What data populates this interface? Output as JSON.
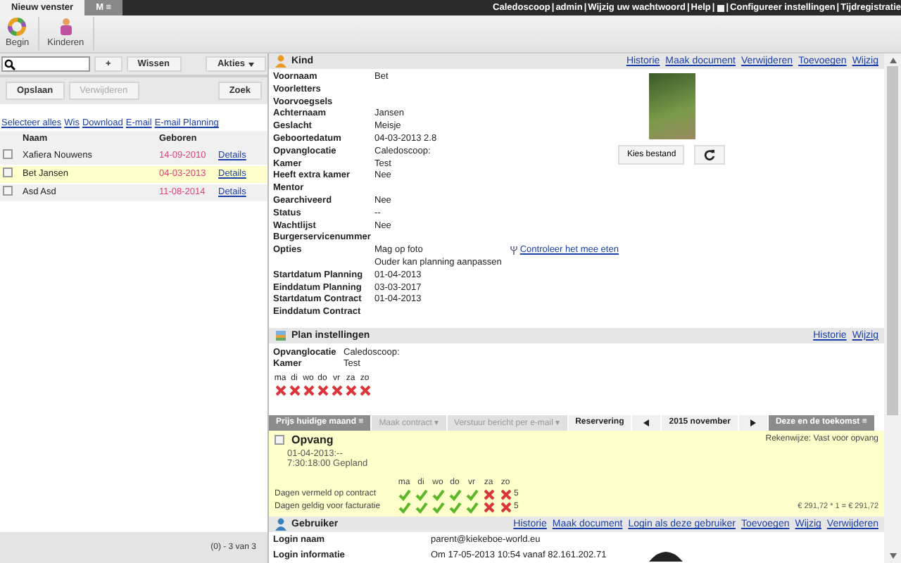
{
  "window_tabs": [
    {
      "label": "Nieuw venster",
      "selected": true
    },
    {
      "label": "M ≡",
      "selected": false
    }
  ],
  "top_links": {
    "separator": "|",
    "items": [
      "Caledoscoop",
      "admin",
      "Wijzig uw wachtwoord",
      "Help",
      "Configureer instellingen",
      "Tijdregistratie"
    ]
  },
  "toolbar": [
    {
      "label": "Begin",
      "kind": "ring"
    },
    {
      "label": "Kinderen",
      "kind": "child"
    }
  ],
  "left_panel": {
    "buttons_row_1": [
      {
        "label": "+",
        "disabled": false
      },
      {
        "label": "Wissen",
        "disabled": false
      }
    ],
    "aktions_button": "Akties",
    "buttons_row_2": [
      {
        "label": "Opslaan",
        "disabled": false
      },
      {
        "label": "Verwijderen",
        "disabled": true
      }
    ],
    "search_button": "Zoek",
    "links": [
      "Selecteer alles",
      "Wis",
      "Download",
      "E-mail",
      "E-mail Planning"
    ],
    "table": {
      "columns": [
        "Naam",
        "Geboren"
      ],
      "rows": [
        {
          "name": "Xafiera Nouwens",
          "born": "14-09-2010",
          "details": "Details",
          "checked": false,
          "selected": false
        },
        {
          "name": "Bet Jansen",
          "born": "04-03-2013",
          "details": "Details",
          "checked": false,
          "selected": true
        },
        {
          "name": "Asd Asd",
          "born": "11-08-2014",
          "details": "Details",
          "checked": false,
          "selected": false
        }
      ]
    },
    "footer": "(0) - 3 van 3"
  },
  "kind": {
    "title": "Kind",
    "actions": [
      "Historie",
      "Maak document",
      "Verwijderen",
      "Toevoegen",
      "Wijzig"
    ],
    "fields": [
      {
        "label": "Voornaam",
        "value": "Bet"
      },
      {
        "label": "Voorletters"
      },
      {
        "label": "Voorvoegsels"
      },
      {
        "label": "Achternaam",
        "value": "Jansen"
      },
      {
        "label": "Geslacht",
        "value": "Meisje"
      },
      {
        "label": "Geboortedatum",
        "value": "04-03-2013  2.8"
      },
      {
        "label": "Opvanglocatie",
        "value": "Caledoscoop:"
      },
      {
        "label": "Kamer",
        "value": "Test"
      },
      {
        "label": "Heeft extra kamer",
        "value": "Nee"
      },
      {
        "label": "Mentor"
      },
      {
        "label": "Gearchiveerd",
        "value": "Nee"
      },
      {
        "label": "Status",
        "value": "--"
      },
      {
        "label": "Wachtlijst",
        "value": "Nee"
      },
      {
        "label": "Burgerservicenummer"
      },
      {
        "label": "Opties",
        "value": "Mag op foto",
        "value_2": "Ouder kan planning aanpassen",
        "link": "Controleer het mee eten"
      },
      {
        "label": "Startdatum Planning",
        "value": "01-04-2013"
      },
      {
        "label": "Einddatum Planning",
        "value": "03-03-2017"
      },
      {
        "label": "Startdatum Contract",
        "value": "01-04-2013"
      },
      {
        "label": "Einddatum Contract"
      }
    ],
    "file_button": "Kies bestand"
  },
  "plan": {
    "title": "Plan instellingen",
    "actions": [
      "Historie",
      "Wijzig"
    ],
    "fields": [
      {
        "label": "Opvanglocatie",
        "value": "Caledoscoop:"
      },
      {
        "label": "Kamer",
        "value": "Test"
      }
    ],
    "days": [
      {
        "label": "ma",
        "on": false
      },
      {
        "label": "di",
        "on": false
      },
      {
        "label": "wo",
        "on": false
      },
      {
        "label": "do",
        "on": false
      },
      {
        "label": "vr",
        "on": false
      },
      {
        "label": "za",
        "on": false
      },
      {
        "label": "zo",
        "on": false
      }
    ]
  },
  "tab_bar": [
    {
      "label": "Prijs huidige maand ≡",
      "kind": "dark"
    },
    {
      "label": "Maak contract ▾",
      "kind": "disabled"
    },
    {
      "label": "Verstuur bericht per e-mail ▾",
      "kind": "disabled"
    },
    {
      "label": "Reservering",
      "kind": "normal"
    },
    {
      "kind": "prev"
    },
    {
      "label": "2015 november",
      "kind": "normal"
    },
    {
      "kind": "next"
    },
    {
      "label": "Deze en de toekomst ≡",
      "kind": "dark"
    }
  ],
  "opvang": {
    "title": "Opvang",
    "checked": false,
    "method": "Rekenwijze: Vast voor opvang",
    "date": "01-04-2013:--",
    "time": "7:30:18:00 Gepland",
    "day_labels": [
      "ma",
      "di",
      "wo",
      "do",
      "vr",
      "za",
      "zo"
    ],
    "rows": [
      {
        "label": "Dagen vermeld op contract",
        "days": [
          {
            "on": true
          },
          {
            "on": true
          },
          {
            "on": true
          },
          {
            "on": true
          },
          {
            "on": true
          },
          {
            "on": false
          },
          {
            "on": false
          }
        ],
        "count": "5"
      },
      {
        "label": "Dagen geldig voor facturatie",
        "days": [
          {
            "on": true
          },
          {
            "on": true
          },
          {
            "on": true
          },
          {
            "on": true
          },
          {
            "on": true
          },
          {
            "on": false
          },
          {
            "on": false
          }
        ],
        "count": "5"
      }
    ],
    "price": "€ 291,72  * 1 = € 291,72"
  },
  "gebruiker": {
    "title": "Gebruiker",
    "actions": [
      "Historie",
      "Maak document",
      "Login als deze gebruiker",
      "Toevoegen",
      "Wijzig",
      "Verwijderen"
    ],
    "fields": [
      {
        "label": "Login naam",
        "value": "parent@kiekeboe-world.eu"
      },
      {
        "label": "Login informatie",
        "value": "Om 17-05-2013 10:54 vanaf 82.161.202.71"
      }
    ]
  }
}
